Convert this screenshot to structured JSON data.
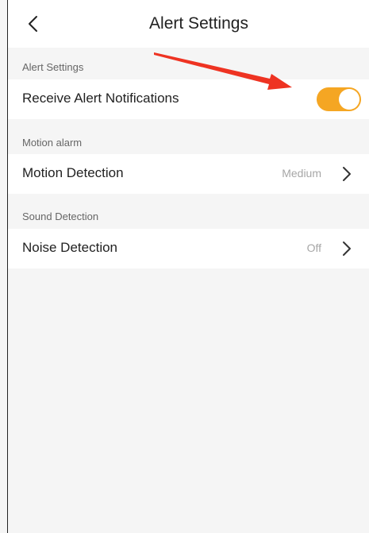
{
  "header": {
    "title": "Alert Settings"
  },
  "sections": [
    {
      "label": "Alert Settings",
      "rows": [
        {
          "label": "Receive Alert Notifications",
          "control": "toggle",
          "toggle_on": true
        }
      ]
    },
    {
      "label": "Motion alarm",
      "rows": [
        {
          "label": "Motion Detection",
          "value": "Medium",
          "control": "chevron"
        }
      ]
    },
    {
      "label": "Sound Detection",
      "rows": [
        {
          "label": "Noise Detection",
          "value": "Off",
          "control": "chevron"
        }
      ]
    }
  ],
  "colors": {
    "toggle_accent": "#f5a623",
    "annotation_arrow": "#ee3322",
    "background": "#f5f5f5"
  },
  "icons": {
    "back": "chevron-left-icon",
    "row_nav": "chevron-right-icon",
    "annotation": "red-arrow-icon"
  }
}
